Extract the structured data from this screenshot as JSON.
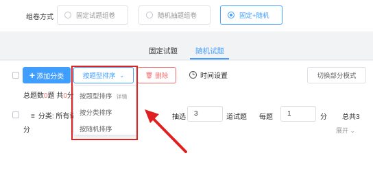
{
  "compose": {
    "label": "组卷方式",
    "options": [
      {
        "label": "固定试题组卷",
        "selected": false
      },
      {
        "label": "随机抽题组卷",
        "selected": false
      },
      {
        "label": "固定+随机",
        "selected": true
      }
    ]
  },
  "tabs": [
    {
      "label": "固定试题",
      "active": false
    },
    {
      "label": "随机试题",
      "active": true
    }
  ],
  "toolbar": {
    "add_label": "添加分类",
    "sort_label": "按题型排序",
    "delete_label": "删除",
    "time_label": "时间设置",
    "switch_label": "切换部分模式"
  },
  "summary": {
    "prefix": "总题数",
    "count": "0",
    "mid": "题 共",
    "score": "0",
    "suffix": "分"
  },
  "category_row": {
    "label": "分类: 所有试",
    "draw_label": "抽选",
    "draw_value": "3",
    "questions_label": "道试题",
    "per_label": "每题",
    "per_value": "1",
    "unit": "分",
    "total": "总共3",
    "total_unit": "分",
    "expand_label": "展开"
  },
  "sort_menu": [
    {
      "label": "按题型排序",
      "detail": "详情"
    },
    {
      "label": "按分类排序",
      "detail": ""
    },
    {
      "label": "按随机排序",
      "detail": ""
    }
  ],
  "colors": {
    "accent": "#409eff",
    "danger": "#f56c6c",
    "annotation": "#e02020"
  }
}
